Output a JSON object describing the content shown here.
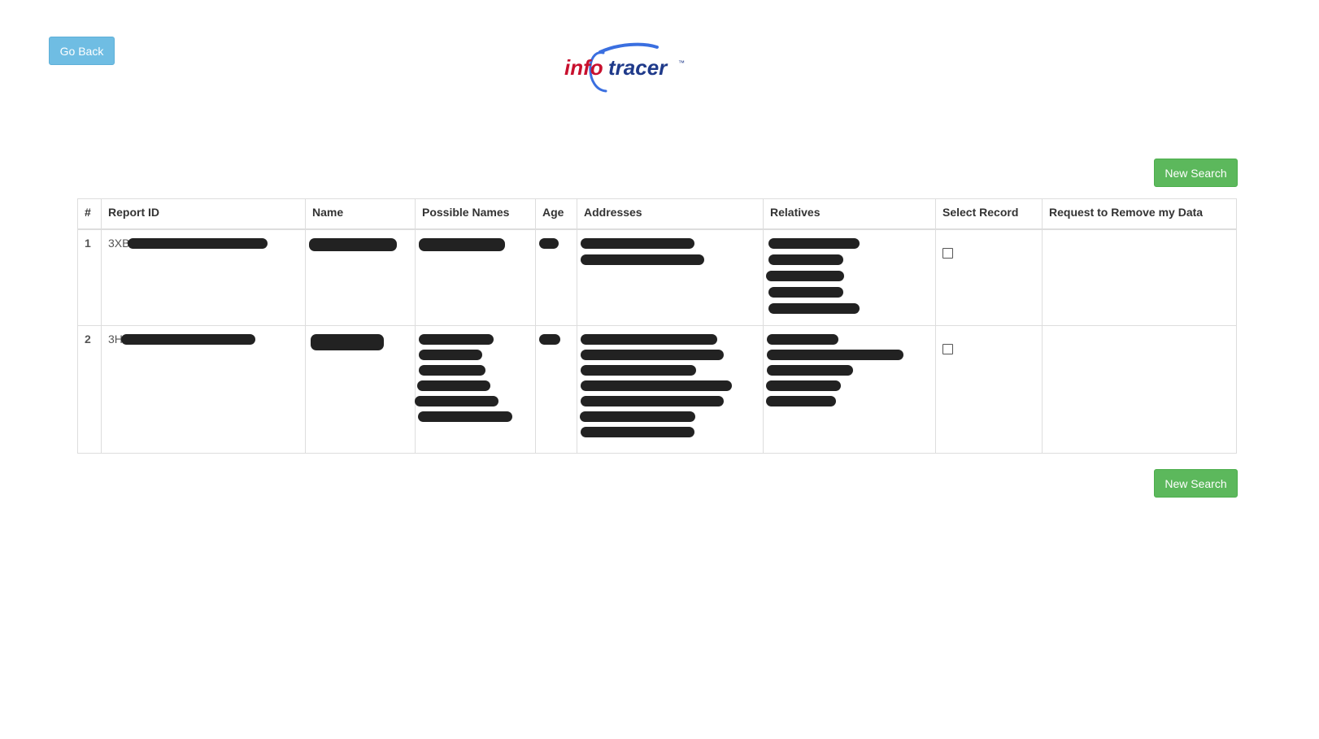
{
  "header": {
    "go_back_label": "Go Back",
    "logo": {
      "part1": "info",
      "part2": "tracer",
      "trademark": "™",
      "colors": {
        "info": "#c8102e",
        "tracer": "#1f3a8a",
        "swoosh": "#3a6fe0"
      }
    }
  },
  "actions": {
    "new_search_label": "New Search"
  },
  "table": {
    "columns": [
      "#",
      "Report ID",
      "Name",
      "Possible Names",
      "Age",
      "Addresses",
      "Relatives",
      "Select Record",
      "Request to Remove my Data"
    ],
    "rows": [
      {
        "num": "1",
        "report_id_prefix": "3XB",
        "selected": false
      },
      {
        "num": "2",
        "report_id_prefix": "3H",
        "selected": false
      }
    ]
  },
  "colors": {
    "go_back": "#6fbde3",
    "new_search": "#5cb85c",
    "redaction": "#222222",
    "border": "#dddddd"
  }
}
